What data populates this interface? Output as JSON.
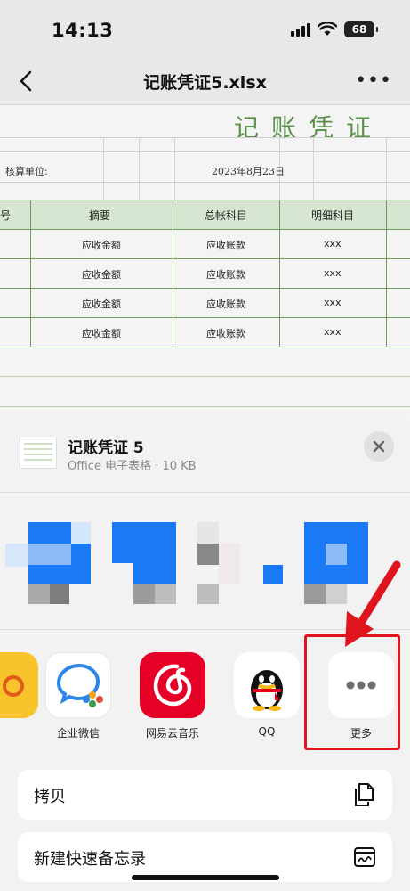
{
  "status_bar": {
    "time": "14:13",
    "battery": "68"
  },
  "nav": {
    "title": "记账凭证5.xlsx"
  },
  "sheet": {
    "title": "记账凭证",
    "unit_label": "核算单位:",
    "date": "2023年8月23日",
    "col_partial": "号",
    "headers": [
      "摘要",
      "总帐科目",
      "明细科目"
    ],
    "rows": [
      [
        "应收金额",
        "应收账款",
        "xxx"
      ],
      [
        "应收金额",
        "应收账款",
        "xxx"
      ],
      [
        "应收金额",
        "应收账款",
        "xxx"
      ],
      [
        "应收金额",
        "应收账款",
        "xxx"
      ]
    ]
  },
  "share": {
    "file_name": "记账凭证 5",
    "file_meta": "Office 电子表格 · 10 KB",
    "apps": [
      {
        "label": "企业微信",
        "icon": "wecom-icon"
      },
      {
        "label": "网易云音乐",
        "icon": "netease-music-icon"
      },
      {
        "label": "QQ",
        "icon": "qq-icon"
      },
      {
        "label": "更多",
        "icon": "more-icon"
      }
    ],
    "actions": [
      {
        "label": "拷贝",
        "icon": "copy-icon"
      },
      {
        "label": "新建快速备忘录",
        "icon": "quick-note-icon"
      }
    ]
  },
  "colors": {
    "accent_red": "#e0141c",
    "sheet_green": "#5a8f4b",
    "netease_red": "#e60026",
    "wecom_blue": "#2b86e8"
  }
}
